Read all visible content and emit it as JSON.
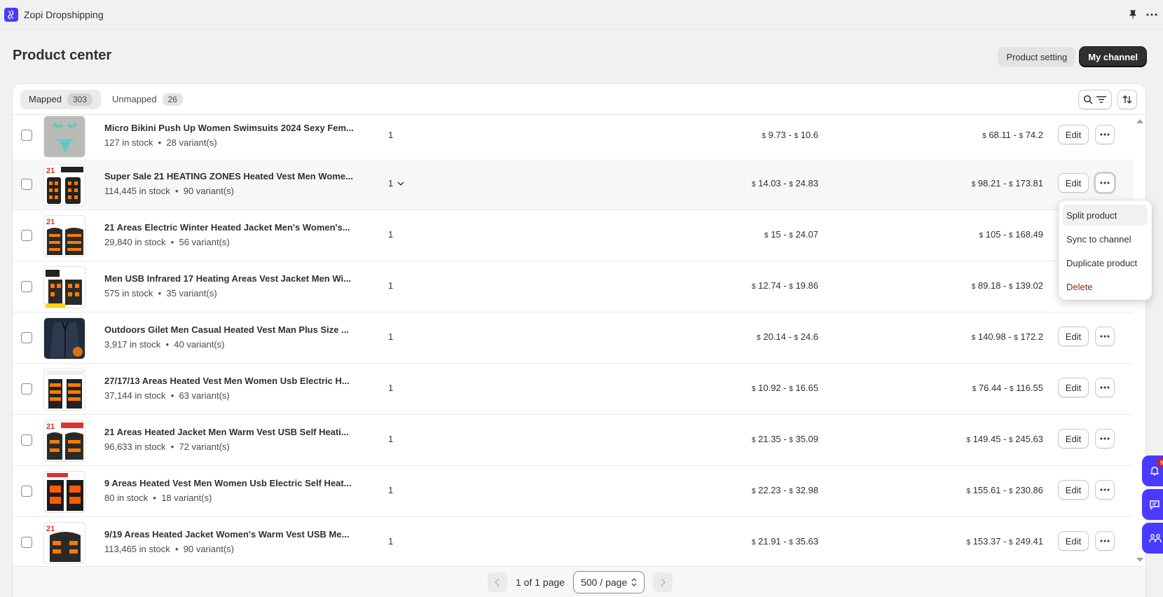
{
  "app": {
    "title": "Zopi Dropshipping"
  },
  "page": {
    "title": "Product center"
  },
  "header": {
    "product_setting_label": "Product setting",
    "my_channel_label": "My channel"
  },
  "tabs": [
    {
      "label": "Mapped",
      "count": "303"
    },
    {
      "label": "Unmapped",
      "count": "26"
    }
  ],
  "products": [
    {
      "name": "Micro Bikini Push Up Women Swimsuits 2024 Sexy Fem...",
      "stock": "127 in stock",
      "variants": "28 variant(s)",
      "qty": "1",
      "cost_from": "9.73",
      "cost_to": "10.6",
      "price_from": "68.11",
      "price_to": "74.2"
    },
    {
      "name": "Super Sale 21 HEATING ZONES Heated Vest Men Wome...",
      "stock": "114,445 in stock",
      "variants": "90 variant(s)",
      "qty": "1",
      "cost_from": "14.03",
      "cost_to": "24.83",
      "price_from": "98.21",
      "price_to": "173.81"
    },
    {
      "name": "21 Areas Electric Winter Heated Jacket Men's Women's...",
      "stock": "29,840 in stock",
      "variants": "56 variant(s)",
      "qty": "1",
      "cost_from": "15",
      "cost_to": "24.07",
      "price_from": "105",
      "price_to": "168.49"
    },
    {
      "name": "Men USB Infrared 17 Heating Areas Vest Jacket Men Wi...",
      "stock": "575 in stock",
      "variants": "35 variant(s)",
      "qty": "1",
      "cost_from": "12.74",
      "cost_to": "19.86",
      "price_from": "89.18",
      "price_to": "139.02"
    },
    {
      "name": "Outdoors Gilet Men Casual Heated Vest Man Plus Size ...",
      "stock": "3,917 in stock",
      "variants": "40 variant(s)",
      "qty": "1",
      "cost_from": "20.14",
      "cost_to": "24.6",
      "price_from": "140.98",
      "price_to": "172.2"
    },
    {
      "name": "27/17/13 Areas Heated Vest Men Women Usb Electric H...",
      "stock": "37,144 in stock",
      "variants": "63 variant(s)",
      "qty": "1",
      "cost_from": "10.92",
      "cost_to": "16.65",
      "price_from": "76.44",
      "price_to": "116.55"
    },
    {
      "name": "21 Areas Heated Jacket Men Warm Vest USB Self Heati...",
      "stock": "96,633 in stock",
      "variants": "72 variant(s)",
      "qty": "1",
      "cost_from": "21.35",
      "cost_to": "35.09",
      "price_from": "149.45",
      "price_to": "245.63"
    },
    {
      "name": "9 Areas Heated Vest Men Women Usb Electric Self Heat...",
      "stock": "80 in stock",
      "variants": "18 variant(s)",
      "qty": "1",
      "cost_from": "22.23",
      "cost_to": "32.98",
      "price_from": "155.61",
      "price_to": "230.86"
    },
    {
      "name": "9/19 Areas Heated Jacket Women's Warm Vest USB Me...",
      "stock": "113,465 in stock",
      "variants": "90 variant(s)",
      "qty": "1",
      "cost_from": "21.91",
      "cost_to": "35.63",
      "price_from": "153.37",
      "price_to": "249.41"
    }
  ],
  "currency_symbol": "$",
  "row_labels": {
    "edit": "Edit",
    "bullet": "•",
    "range_sep": "-"
  },
  "dropdown": {
    "items": [
      "Split product",
      "Sync to channel",
      "Duplicate product"
    ],
    "danger_item": "Delete"
  },
  "pagination": {
    "page_text": "1 of 1 page",
    "per_page": "500 / page"
  },
  "floating": {
    "badge": "9"
  },
  "colors": {
    "brand": "#4a3aff",
    "danger": "#8e1f0b",
    "primary_button": "#303030"
  }
}
